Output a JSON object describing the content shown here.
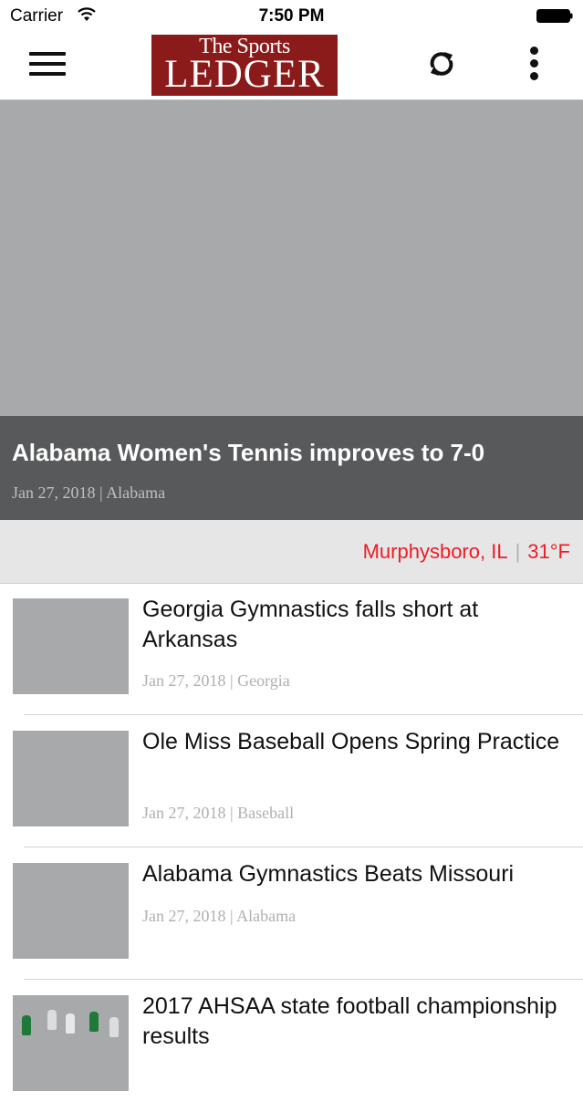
{
  "status_bar": {
    "carrier": "Carrier",
    "time": "7:50 PM"
  },
  "nav": {
    "logo_top": "The Sports",
    "logo_bottom": "LEDGER",
    "logo_color": "#8b1a1a"
  },
  "hero": {
    "title": "Alabama Women's Tennis improves to 7-0",
    "meta": "Jan 27, 2018 | Alabama"
  },
  "weather": {
    "location": "Murphysboro, IL",
    "separator": "|",
    "temperature": "31°F",
    "color": "#ee1c24"
  },
  "articles": [
    {
      "title": "Georgia Gymnastics falls short at Arkansas",
      "meta": "Jan 27, 2018 | Georgia"
    },
    {
      "title": "Ole Miss Baseball Opens Spring Practice",
      "meta": "Jan 27, 2018 | Baseball"
    },
    {
      "title": "Alabama Gymnastics Beats Missouri",
      "meta": "Jan 27, 2018 | Alabama"
    },
    {
      "title": "2017 AHSAA state football championship results",
      "meta": ""
    }
  ],
  "icons": {
    "menu": "hamburger-menu-icon",
    "refresh": "refresh-icon",
    "more": "more-vertical-icon",
    "wifi": "wifi-icon",
    "battery": "battery-icon"
  }
}
